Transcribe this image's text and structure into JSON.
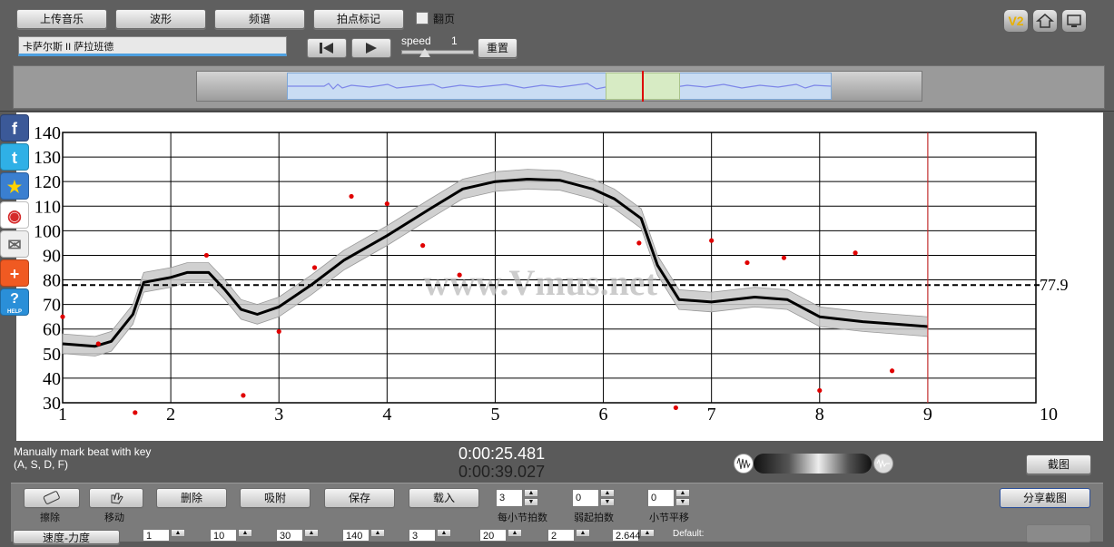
{
  "toolbar": {
    "upload_label": "上传音乐",
    "waveform_label": "波形",
    "spectrum_label": "频谱",
    "tap_label": "拍点标记",
    "pageflip_label": "翻页",
    "speed_label": "speed",
    "speed_value": "1",
    "reset_label": "重置",
    "song_title": "卡萨尔斯 II 萨拉班德",
    "version_badge": "V2"
  },
  "share_icons": [
    "facebook-icon",
    "twitter-icon",
    "star-icon",
    "weibo-icon",
    "mail-icon",
    "plus-icon",
    "help-icon"
  ],
  "help_text": "HELP",
  "chart": {
    "watermark": "www.Vmus.net",
    "reference_label": "77.9"
  },
  "chart_data": {
    "type": "line",
    "xlim": [
      1,
      10
    ],
    "ylim": [
      30,
      140
    ],
    "x_ticks": [
      "1",
      "2",
      "3",
      "4",
      "5",
      "6",
      "7",
      "8",
      "9",
      "10"
    ],
    "y_ticks": [
      "140",
      "130",
      "120",
      "110",
      "100",
      "90",
      "80",
      "70",
      "60",
      "50",
      "40",
      "30"
    ],
    "reference_line": 77.9,
    "cursor_x": 9,
    "grid": true,
    "series": [
      {
        "values_x": [
          1.0,
          1.3,
          1.45,
          1.65,
          1.75,
          2.0,
          2.15,
          2.35,
          2.5,
          2.65,
          2.8,
          3.0,
          3.3,
          3.6,
          4.0,
          4.4,
          4.7,
          5.0,
          5.3,
          5.6,
          5.9,
          6.1,
          6.35,
          6.5,
          6.7,
          7.0,
          7.4,
          7.7,
          8.0,
          8.4,
          8.7,
          9.0
        ],
        "values_y": [
          54,
          53,
          55,
          66,
          79,
          81,
          83,
          83,
          76,
          68,
          66,
          69,
          78,
          88,
          98,
          109,
          117,
          120,
          121,
          120.5,
          117,
          113,
          105,
          86,
          72,
          71,
          73,
          72,
          65,
          63,
          62,
          61
        ]
      }
    ],
    "band_width": 4,
    "scatter": {
      "x": [
        1.0,
        1.33,
        1.67,
        2.33,
        2.67,
        3.0,
        3.33,
        3.67,
        4.0,
        4.33,
        4.67,
        6.33,
        6.67,
        7.0,
        7.33,
        7.67,
        8.0,
        8.33,
        8.67
      ],
      "y": [
        65,
        54,
        26,
        90,
        33,
        59,
        85,
        114,
        111,
        94,
        82,
        95,
        28,
        96,
        87,
        89,
        35,
        91,
        43
      ]
    }
  },
  "status": {
    "hint_line1": "Manually mark beat with key",
    "hint_line2": "(A, S, D, F)",
    "current_time": "0:00:25.481",
    "total_time": "0:00:39.027",
    "screenshot_label": "截图"
  },
  "bottom": {
    "erase_label": "擦除",
    "move_label": "移动",
    "delete_label": "删除",
    "snap_label": "吸附",
    "save_label": "保存",
    "load_label": "载入",
    "beats_per_bar": "3",
    "beats_per_bar_label": "每小节拍数",
    "pickup": "0",
    "pickup_label": "弱起拍数",
    "bar_shift": "0",
    "bar_shift_label": "小节平移",
    "share_screenshot_label": "分享截图",
    "tempo_dynamics_label": "速度-力度",
    "row3_values": [
      "1",
      "10",
      "30",
      "140",
      "3",
      "20",
      "2",
      "2.644"
    ],
    "default_label": "Default:"
  }
}
